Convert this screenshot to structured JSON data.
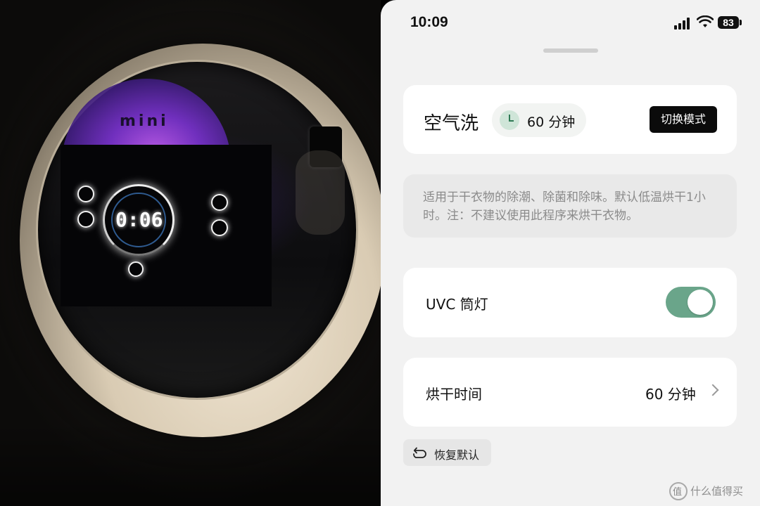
{
  "photo": {
    "brand_text": "mini",
    "display_time": "0:06"
  },
  "status_bar": {
    "time": "10:09",
    "battery": "83"
  },
  "mode_card": {
    "mode_name": "空气洗",
    "duration": "60 分钟",
    "switch_button_label": "切换模式"
  },
  "description": "适用于干衣物的除潮、除菌和除味。默认低温烘干1小时。注：不建议使用此程序来烘干衣物。",
  "uvc_row": {
    "label": "UVC 筒灯",
    "enabled": true
  },
  "dry_time_row": {
    "label": "烘干时间",
    "value": "60 分钟"
  },
  "reset_button": {
    "label": "恢复默认"
  },
  "watermark": {
    "text": "什么值得买"
  },
  "colors": {
    "toggle_on": "#6aa58a",
    "accent_dark": "#0b0b0b",
    "clock_bg": "#cfe5d8"
  }
}
